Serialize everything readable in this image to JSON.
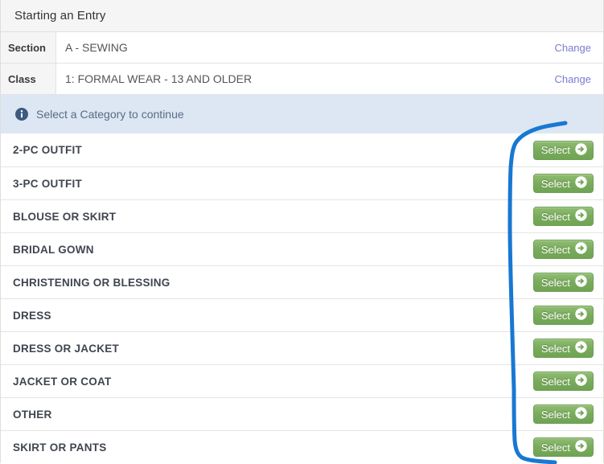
{
  "header": {
    "title": "Starting an Entry"
  },
  "details": [
    {
      "label": "Section",
      "value": "A - SEWING",
      "change_label": "Change"
    },
    {
      "label": "Class",
      "value": "1: FORMAL WEAR - 13 AND OLDER",
      "change_label": "Change"
    }
  ],
  "banner": {
    "icon": "info-circle-icon",
    "text": "Select a Category to continue"
  },
  "categories": [
    {
      "name": "2-PC OUTFIT",
      "action_label": "Select"
    },
    {
      "name": "3-PC OUTFIT",
      "action_label": "Select"
    },
    {
      "name": "BLOUSE OR SKIRT",
      "action_label": "Select"
    },
    {
      "name": "BRIDAL GOWN",
      "action_label": "Select"
    },
    {
      "name": "CHRISTENING OR BLESSING",
      "action_label": "Select"
    },
    {
      "name": "DRESS",
      "action_label": "Select"
    },
    {
      "name": "DRESS OR JACKET",
      "action_label": "Select"
    },
    {
      "name": "JACKET OR COAT",
      "action_label": "Select"
    },
    {
      "name": "OTHER",
      "action_label": "Select"
    },
    {
      "name": "SKIRT OR PANTS",
      "action_label": "Select"
    }
  ],
  "annotation": {
    "type": "hand-drawn-bracket",
    "color": "#1878d2"
  },
  "colors": {
    "header_bg": "#f5f5f5",
    "banner_bg": "#dce7f3",
    "button_green": "#79ab5c",
    "link_purple": "#7b7bd4",
    "annotation_blue": "#1878d2"
  }
}
